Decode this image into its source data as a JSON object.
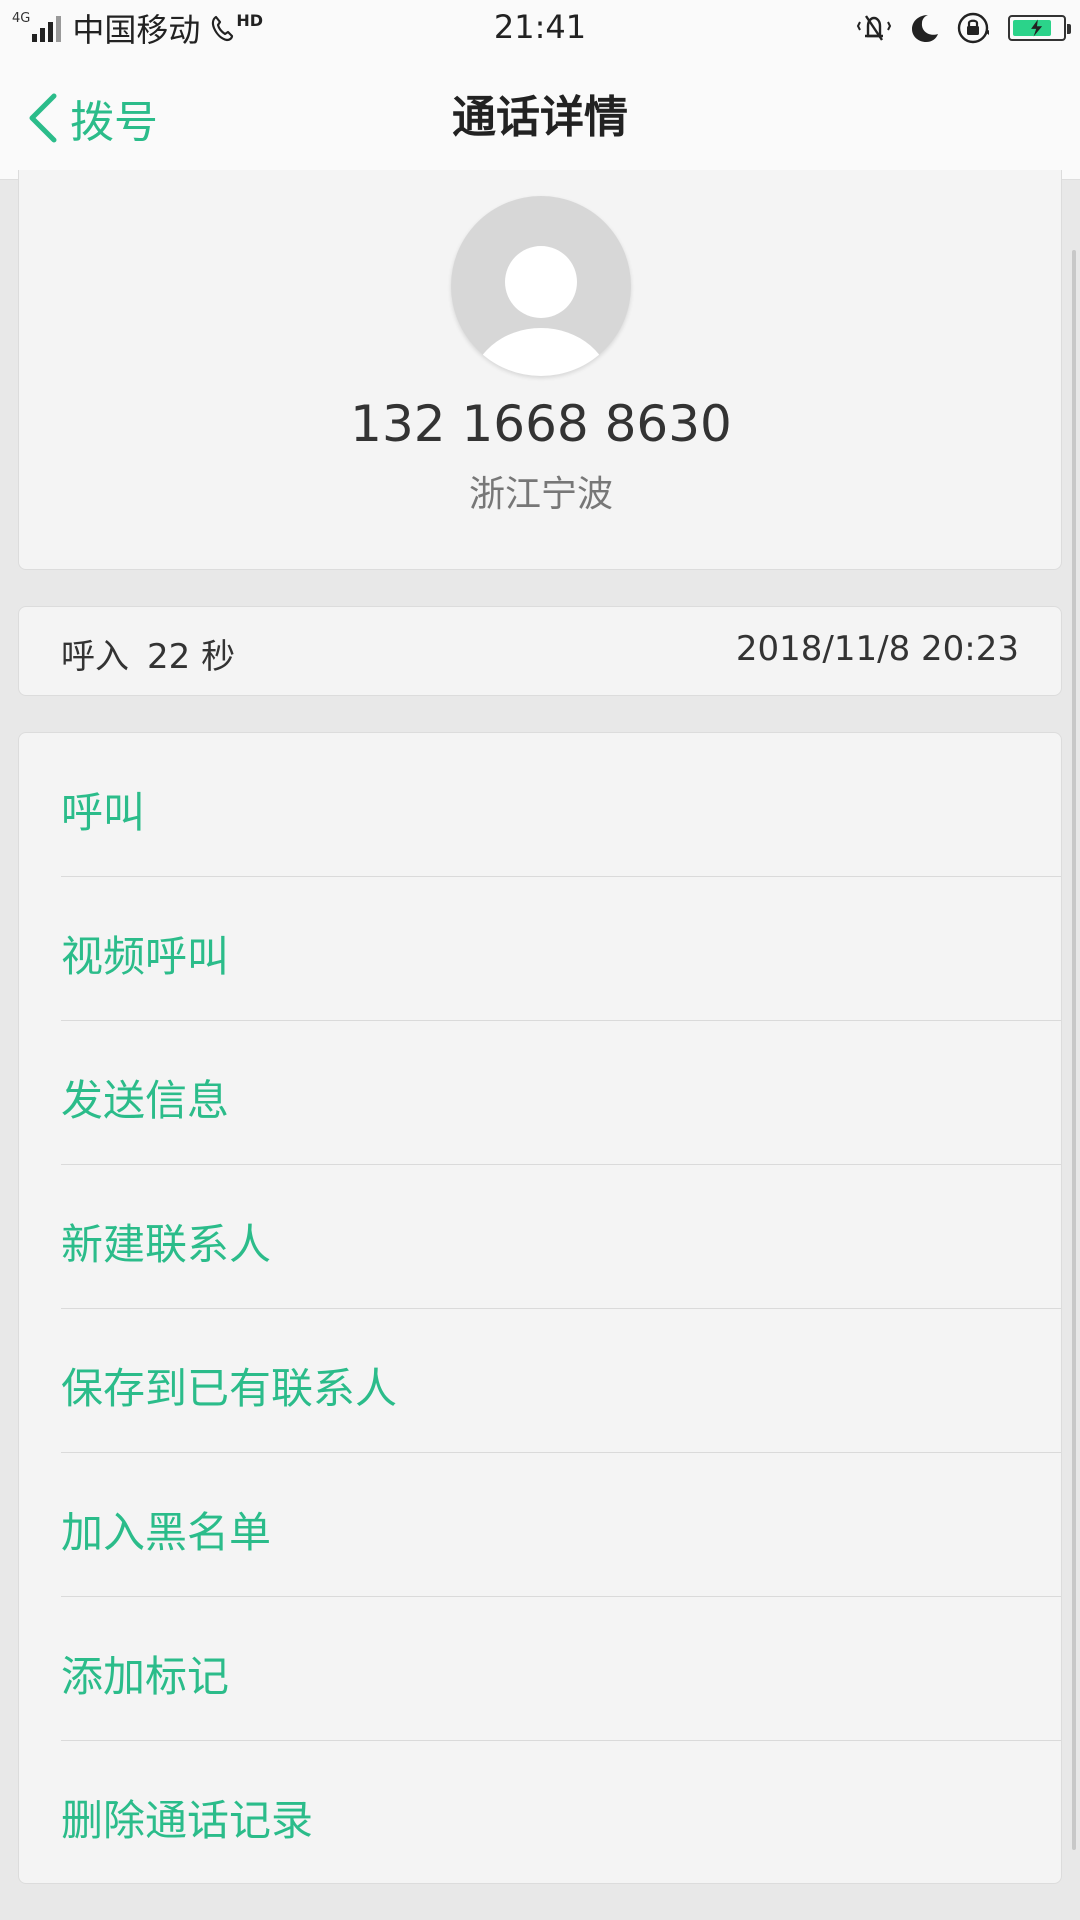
{
  "status_bar": {
    "network": "4G",
    "carrier": "中国移动",
    "hd": "HD",
    "time": "21:41",
    "battery_level": 0.8,
    "icons": [
      "signal-icon",
      "hd-call-icon",
      "vibrate-icon",
      "moon-icon",
      "rotation-lock-icon",
      "battery-icon"
    ]
  },
  "header": {
    "back_label": "拨号",
    "title": "通话详情"
  },
  "contact": {
    "number": "132 1668 8630",
    "location": "浙江宁波"
  },
  "call": {
    "type": "呼入",
    "duration": "22 秒",
    "datetime": "2018/11/8 20:23"
  },
  "actions": [
    {
      "label": "呼叫"
    },
    {
      "label": "视频呼叫"
    },
    {
      "label": "发送信息"
    },
    {
      "label": "新建联系人"
    },
    {
      "label": "保存到已有联系人"
    },
    {
      "label": "加入黑名单"
    },
    {
      "label": "添加标记"
    },
    {
      "label": "删除通话记录"
    }
  ],
  "colors": {
    "accent": "#2bbc8a",
    "background": "#e8e8e8",
    "card": "#f4f4f4"
  }
}
